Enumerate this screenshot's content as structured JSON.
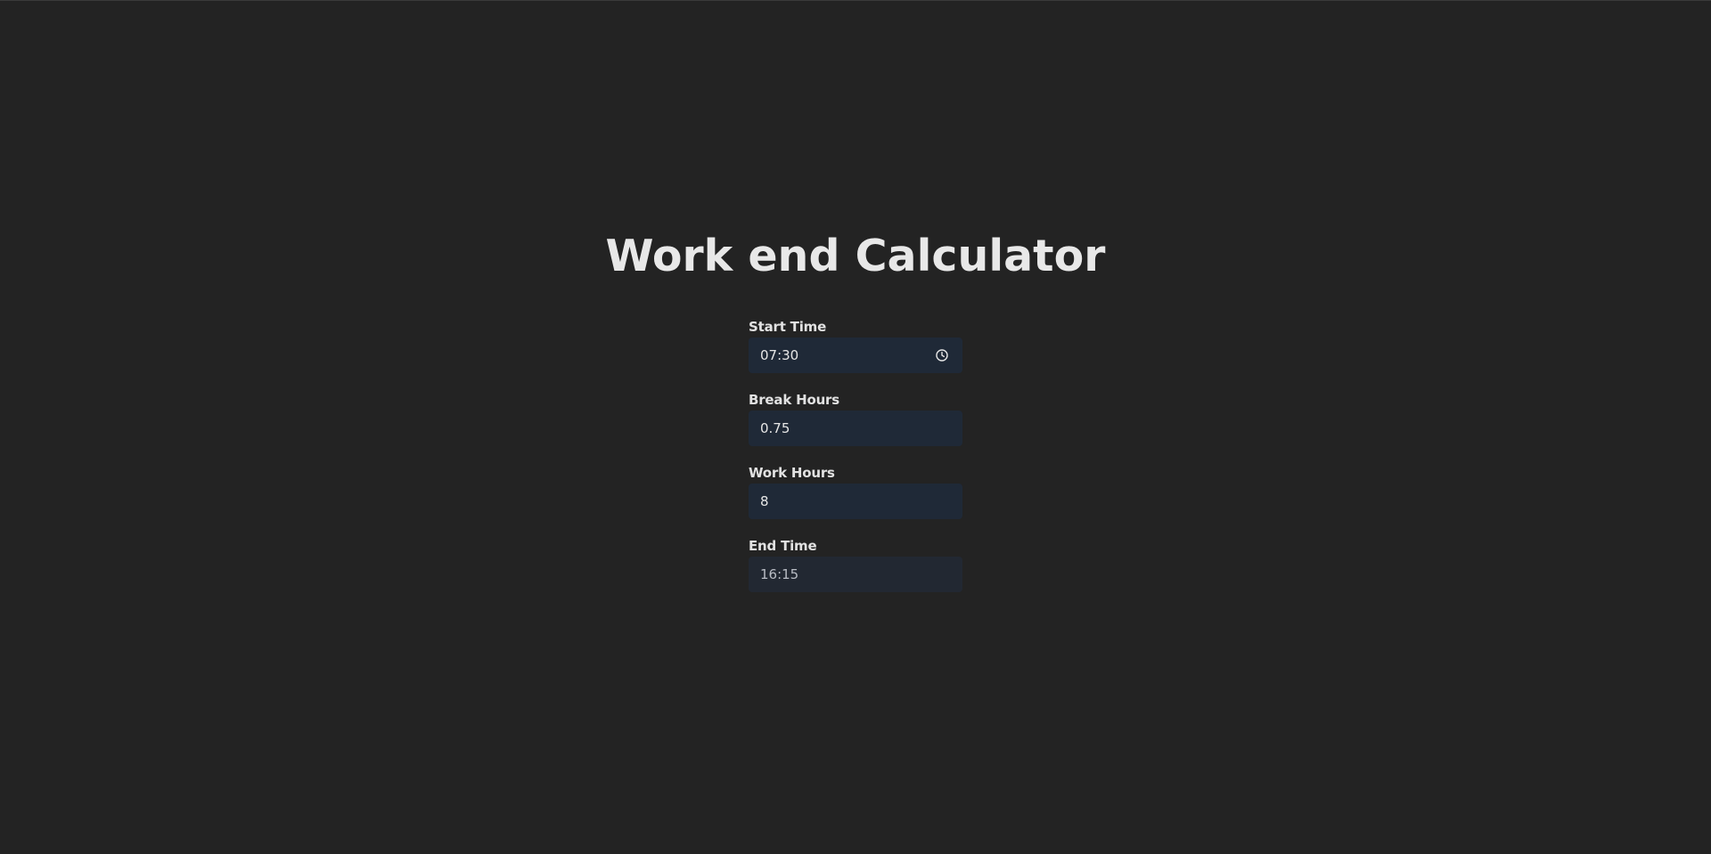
{
  "page": {
    "title": "Work end Calculator"
  },
  "form": {
    "start_time": {
      "label": "Start Time",
      "value": "07:30",
      "icon": "clock-icon"
    },
    "break_hours": {
      "label": "Break Hours",
      "value": "0.75"
    },
    "work_hours": {
      "label": "Work Hours",
      "value": "8"
    },
    "end_time": {
      "label": "End Time",
      "value": "16:15"
    }
  },
  "colors": {
    "background": "#232323",
    "input_background": "#1f2937",
    "readonly_background": "#222832",
    "text": "#e6e6e6"
  }
}
